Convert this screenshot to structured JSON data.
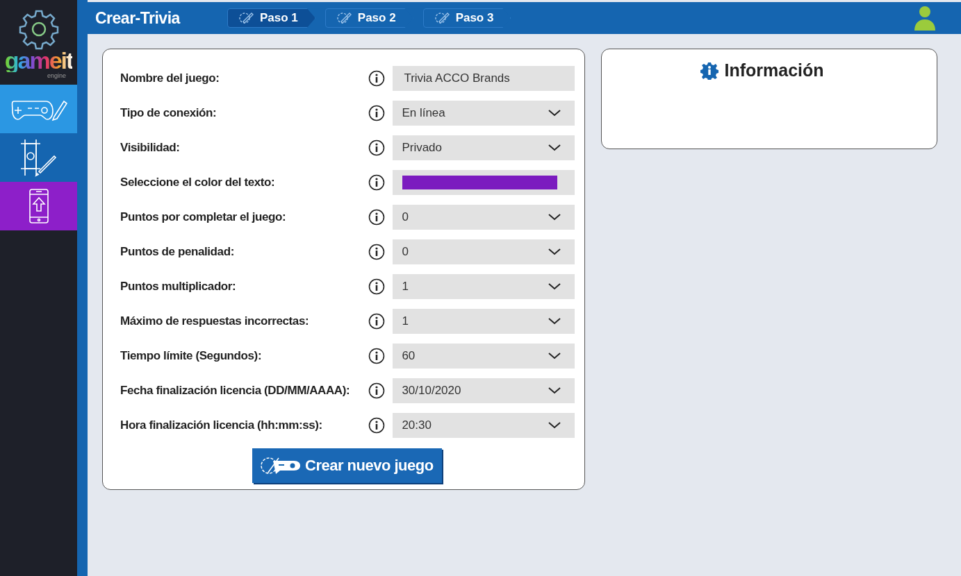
{
  "logo": {
    "name": "gameit",
    "tagline": "engine"
  },
  "sidebar": {
    "items": [
      {
        "kind": "create",
        "color": "#2b97e3"
      },
      {
        "kind": "design",
        "color": "#1565b0"
      },
      {
        "kind": "publish",
        "color": "#8d1fc9"
      }
    ]
  },
  "header": {
    "title": "Crear-Trivia",
    "steps": [
      {
        "label": "Paso 1",
        "selected": true
      },
      {
        "label": "Paso 2",
        "selected": false
      },
      {
        "label": "Paso 3",
        "selected": false
      }
    ]
  },
  "form": {
    "fields": [
      {
        "label": "Nombre del juego:",
        "kind": "text",
        "value": "Trivia ACCO Brands"
      },
      {
        "label": "Tipo de conexión:",
        "kind": "select",
        "value": "En línea"
      },
      {
        "label": "Visibilidad:",
        "kind": "select",
        "value": "Privado"
      },
      {
        "label": "Seleccione el color del texto:",
        "kind": "color",
        "color": "#7b1bbf"
      },
      {
        "label": "Puntos por completar el juego:",
        "kind": "select",
        "value": "0"
      },
      {
        "label": "Puntos de penalidad:",
        "kind": "select",
        "value": "0"
      },
      {
        "label": "Puntos multiplicador:",
        "kind": "select",
        "value": "1"
      },
      {
        "label": "Máximo de respuestas incorrectas:",
        "kind": "select",
        "value": "1"
      },
      {
        "label": "Tiempo límite (Segundos):",
        "kind": "select",
        "value": "60"
      },
      {
        "label": "Fecha finalización licencia (DD/MM/AAAA):",
        "kind": "select",
        "value": "30/10/2020"
      },
      {
        "label": "Hora finalización licencia (hh:mm:ss):",
        "kind": "select",
        "value": "20:30"
      }
    ],
    "submit": "Crear nuevo juego"
  },
  "info": {
    "title": "Información"
  }
}
